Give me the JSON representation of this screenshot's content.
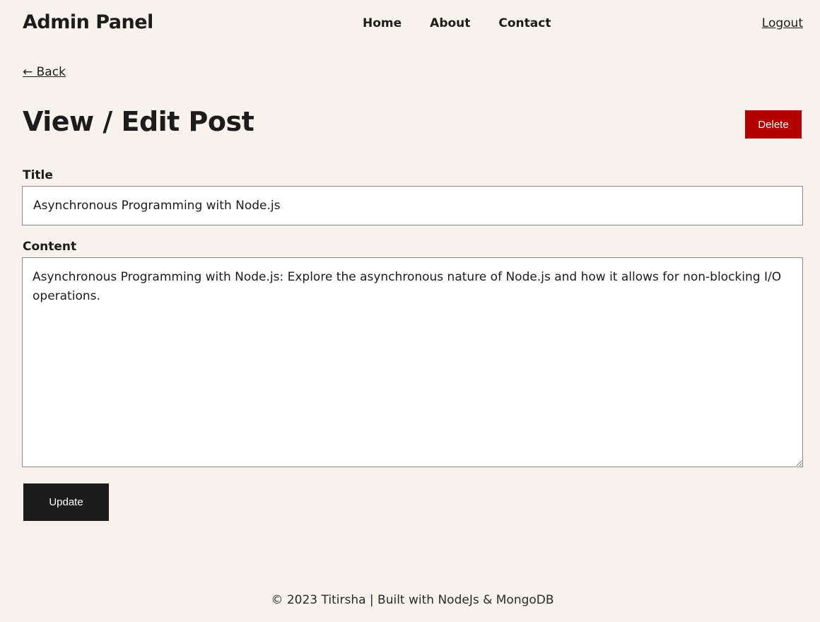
{
  "header": {
    "site_title": "Admin Panel",
    "nav": [
      {
        "label": "Home"
      },
      {
        "label": "About"
      },
      {
        "label": "Contact"
      }
    ],
    "logout_label": "Logout"
  },
  "back_link": "← Back",
  "page_title": "View / Edit Post",
  "delete_label": "Delete",
  "form": {
    "title_label": "Title",
    "title_value": "Asynchronous Programming with Node.js",
    "content_label": "Content",
    "content_value": "Asynchronous Programming with Node.js: Explore the asynchronous nature of Node.js and how it allows for non-blocking I/O operations.",
    "update_label": "Update"
  },
  "footer": {
    "text": "© 2023 Titirsha | Built with NodeJs & MongoDB"
  },
  "colors": {
    "background": "#f7f2ec",
    "text": "#1c1c1c",
    "delete_button": "#b30000",
    "update_button": "#1c1c1c"
  }
}
